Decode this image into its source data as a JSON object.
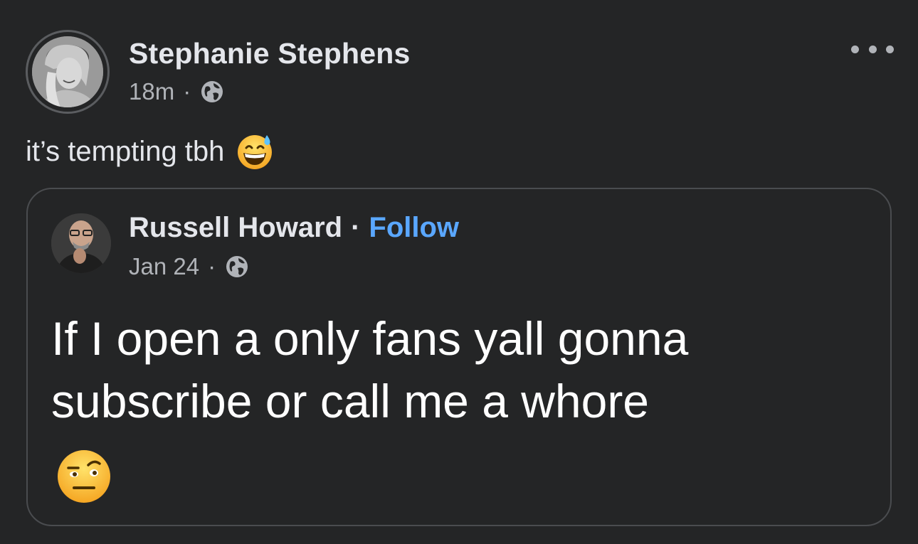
{
  "post": {
    "author_name": "Stephanie Stephens",
    "timestamp": "18m",
    "separator": "·",
    "audience_icon": "globe-icon",
    "menu_icon": "more-options-icon",
    "text": "it’s tempting tbh",
    "text_emoji": "grinning-face-with-sweat-emoji"
  },
  "shared_post": {
    "author_name": "Russell Howard",
    "separator": "·",
    "follow_label": "Follow",
    "timestamp": "Jan 24",
    "audience_icon": "globe-icon",
    "text": "If I open a only fans yall gonna subscribe or call me a whore",
    "text_emoji": "face-with-raised-eyebrow-emoji"
  },
  "colors": {
    "background": "#242526",
    "primary_text": "#e4e6eb",
    "secondary_text": "#b0b3b8",
    "link": "#5aa7ff",
    "card_border": "#4a4c4f"
  }
}
